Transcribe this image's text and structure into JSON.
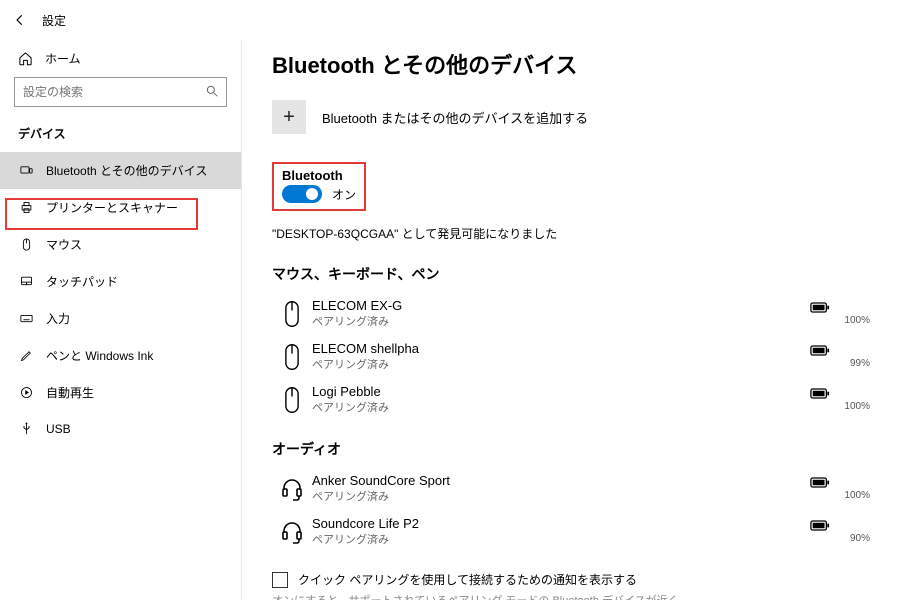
{
  "window": {
    "title": "設定"
  },
  "sidebar": {
    "home": "ホーム",
    "search_placeholder": "設定の検索",
    "category": "デバイス",
    "items": [
      {
        "label": "Bluetooth とその他のデバイス",
        "selected": true
      },
      {
        "label": "プリンターとスキャナー"
      },
      {
        "label": "マウス"
      },
      {
        "label": "タッチパッド"
      },
      {
        "label": "入力"
      },
      {
        "label": "ペンと Windows Ink"
      },
      {
        "label": "自動再生"
      },
      {
        "label": "USB"
      }
    ]
  },
  "main": {
    "heading": "Bluetooth とその他のデバイス",
    "add_label": "Bluetooth またはその他のデバイスを追加する",
    "bt": {
      "label": "Bluetooth",
      "state": "オン"
    },
    "discoverable": "\"DESKTOP-63QCGAA\" として発見可能になりました",
    "group_mouse": "マウス、キーボード、ペン",
    "mouse_devices": [
      {
        "name": "ELECOM EX-G",
        "status": "ペアリング済み",
        "battery": "100%"
      },
      {
        "name": "ELECOM shellpha",
        "status": "ペアリング済み",
        "battery": "99%"
      },
      {
        "name": "Logi Pebble",
        "status": "ペアリング済み",
        "battery": "100%"
      }
    ],
    "group_audio": "オーディオ",
    "audio_devices": [
      {
        "name": "Anker SoundCore Sport",
        "status": "ペアリング済み",
        "battery": "100%"
      },
      {
        "name": "Soundcore Life P2",
        "status": "ペアリング済み",
        "battery": "90%"
      }
    ],
    "quick_pair": "クイック ペアリングを使用して接続するための通知を表示する",
    "quick_hint": "オンにすると、サポートされているペアリング モードの Bluetooth デバイスが近く"
  }
}
